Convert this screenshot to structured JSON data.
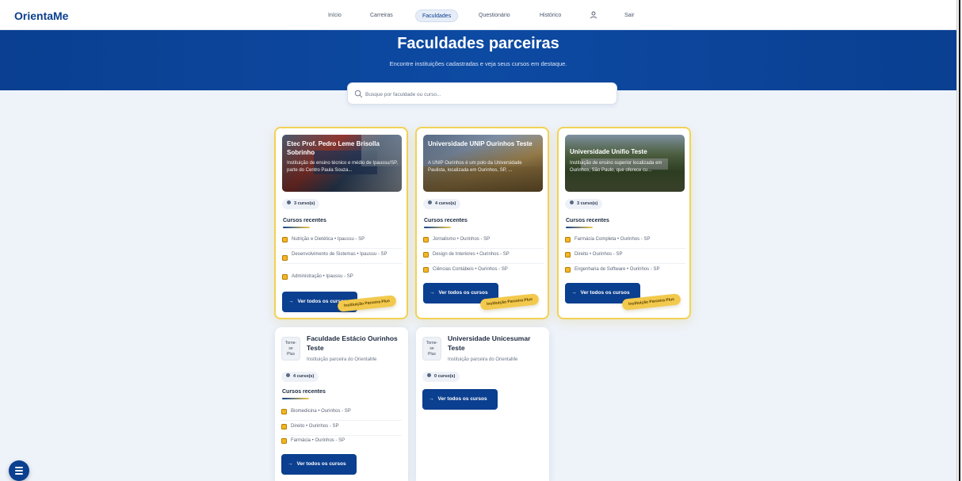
{
  "brand": "OrientaMe",
  "nav": {
    "items": [
      "Início",
      "Carreiras",
      "Faculdades",
      "Questionário",
      "Histórico"
    ],
    "active": "Faculdades",
    "logout": "Sair"
  },
  "hero": {
    "title": "Faculdades parceiras",
    "subtitle": "Encontre instituições cadastradas e veja seus cursos em destaque."
  },
  "search": {
    "placeholder": "Busque por faculdade ou curso..."
  },
  "common": {
    "recent_courses": "Cursos recentes",
    "view_all": "Ver todos os cursos",
    "partner_badge": "Instituição Parceira Plus",
    "partner_sub": "Instituição parceira do OrientaMe",
    "logo_placeholder": [
      "Torne-",
      "se",
      "Plus"
    ]
  },
  "colors": {
    "primary": "#0b3f8f",
    "gold": "#f2c94c",
    "background": "#eef3fa"
  },
  "cards": [
    {
      "name": "Etec Prof. Pedro Leme Brisolla Sobrinho",
      "description": "Instituição de ensino técnico e médio de Ipaussu/SP, parte do Centro Paula Souza...",
      "count": "3 curso(s)",
      "courses": [
        "Nutrição e Dietética • Ipaussu - SP",
        "Desenvolvimento de Sistemas • Ipaussu - SP",
        "Administração • Ipaussu - SP"
      ]
    },
    {
      "name": "Universidade UNIP Ourinhos Teste",
      "description": "A UNIP Ourinhos é um polo da Universidade Paulista, localizada em Ourinhos, SP, ...",
      "count": "4 curso(s)",
      "courses": [
        "Jornalismo • Ourinhos - SP",
        "Design de Interiores • Ourinhos - SP",
        "Ciências Contábeis • Ourinhos - SP"
      ]
    },
    {
      "name": "Universidade Unifio Teste",
      "description": "Instituição de ensino superior localizada em Ourinhos, São Paulo, que oferece cu...",
      "count": "3 curso(s)",
      "courses": [
        "Farmácia Completa • Ourinhos - SP",
        "Direito • Ourinhos - SP",
        "Engenharia de Software • Ourinhos - SP"
      ]
    },
    {
      "name": "Faculdade Estácio Ourinhos Teste",
      "count": "4 curso(s)",
      "courses": [
        "Biomedicina • Ourinhos - SP",
        "Direito • Ourinhos - SP",
        "Farmácia • Ourinhos - SP"
      ]
    },
    {
      "name": "Universidade Unicesumar Teste",
      "count": "0 curso(s)",
      "courses": []
    }
  ]
}
